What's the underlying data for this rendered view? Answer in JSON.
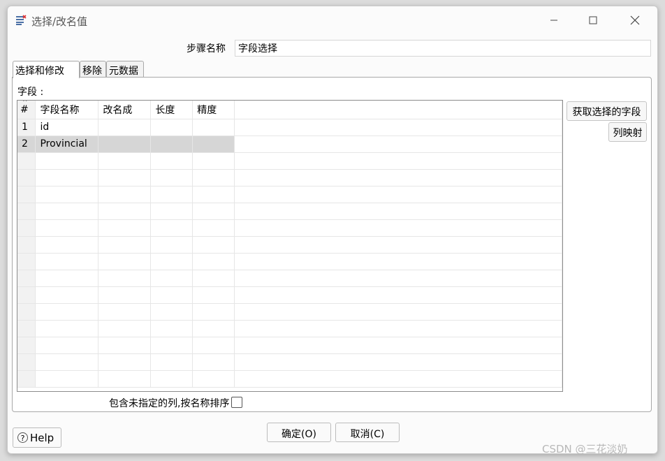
{
  "window": {
    "title": "选择/改名值"
  },
  "step": {
    "label": "步骤名称",
    "value": "字段选择"
  },
  "tabs": [
    {
      "label": "选择和修改"
    },
    {
      "label": "移除"
    },
    {
      "label": "元数据"
    }
  ],
  "fields": {
    "label": "字段 :",
    "columns": [
      "#",
      "字段名称",
      "改名成",
      "长度",
      "精度"
    ],
    "rows": [
      {
        "num": "1",
        "name": "id",
        "rename": "",
        "length": "",
        "precision": ""
      },
      {
        "num": "2",
        "name": "Provincial",
        "rename": "",
        "length": "",
        "precision": ""
      }
    ]
  },
  "buttons": {
    "get_fields": "获取选择的字段",
    "map_columns": "列映射",
    "ok": "确定(O)",
    "cancel": "取消(C)",
    "help": "Help"
  },
  "include_unspecified": {
    "label": "包含未指定的列,按名称排序",
    "checked": false
  },
  "watermark": "CSDN @三花淡奶"
}
